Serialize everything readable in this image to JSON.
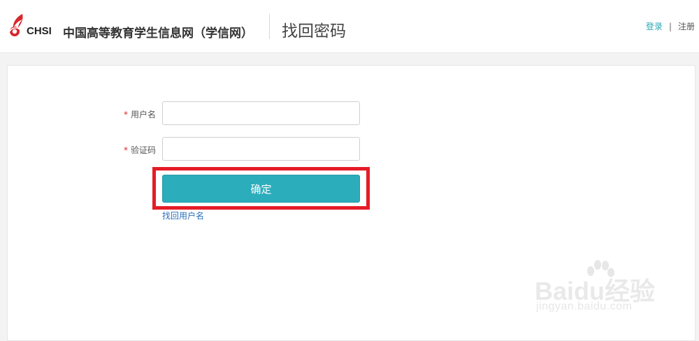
{
  "header": {
    "logo_text": "CHSI",
    "site_name": "中国高等教育学生信息网（学信网）",
    "page_title": "找回密码",
    "login_link": "登录",
    "separator": "|",
    "register_link": "注册"
  },
  "form": {
    "required_mark": "*",
    "username_label": "用户名",
    "username_value": "",
    "captcha_label": "验证码",
    "captcha_value": "",
    "confirm_button": "确定",
    "find_username_link": "找回用户名"
  },
  "watermark": {
    "brand": "Baidu经验",
    "url": "jingyan.baidu.com"
  },
  "colors": {
    "accent": "#2cadbc",
    "highlight": "#e41d27",
    "link": "#2a6fbd",
    "logo_red": "#d8262c"
  }
}
